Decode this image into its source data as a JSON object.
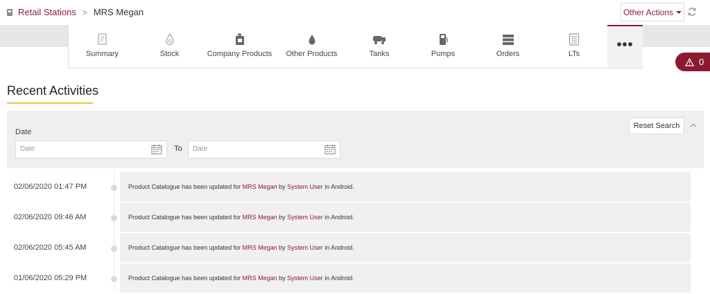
{
  "breadcrumb": {
    "parent": "Retail Stations",
    "separator": ">",
    "current": "MRS Megan"
  },
  "header": {
    "other_actions_label": "Other Actions"
  },
  "tabs": [
    {
      "label": "Summary",
      "icon": "summary-icon"
    },
    {
      "label": "Stock",
      "icon": "stock-icon"
    },
    {
      "label": "Company Products",
      "icon": "company-products-icon"
    },
    {
      "label": "Other Products",
      "icon": "drop-icon"
    },
    {
      "label": "Tanks",
      "icon": "tank-truck-icon"
    },
    {
      "label": "Pumps",
      "icon": "fuel-pump-icon"
    },
    {
      "label": "Orders",
      "icon": "orders-icon"
    },
    {
      "label": "LTs",
      "icon": "list-icon"
    }
  ],
  "more_label": "•••",
  "alerts": {
    "count": "0"
  },
  "section": {
    "title": "Recent Activities"
  },
  "filter": {
    "date_label": "Date",
    "from_placeholder": "Date",
    "to_label": "To",
    "to_placeholder": "Date",
    "reset_label": "Reset Search"
  },
  "activities": [
    {
      "time": "02/06/2020 01:47 PM",
      "text_a": "Product Catalogue has been updated for ",
      "station": "MRS Megan",
      "text_b": " by ",
      "user": "System User",
      "text_c": " in Android."
    },
    {
      "time": "02/06/2020 09:46 AM",
      "text_a": "Product Catalogue has been updated for ",
      "station": "MRS Megan",
      "text_b": " by ",
      "user": "System User",
      "text_c": " in Android."
    },
    {
      "time": "02/06/2020 05:45 AM",
      "text_a": "Product Catalogue has been updated for ",
      "station": "MRS Megan",
      "text_b": " by ",
      "user": "System User",
      "text_c": " in Android."
    },
    {
      "time": "01/06/2020 05:29 PM",
      "text_a": "Product Catalogue has been updated for ",
      "station": "MRS Megan",
      "text_b": " by ",
      "user": "System User",
      "text_c": " in Android."
    }
  ],
  "colors": {
    "accent": "#8b1a30",
    "underline": "#e8c23a"
  }
}
